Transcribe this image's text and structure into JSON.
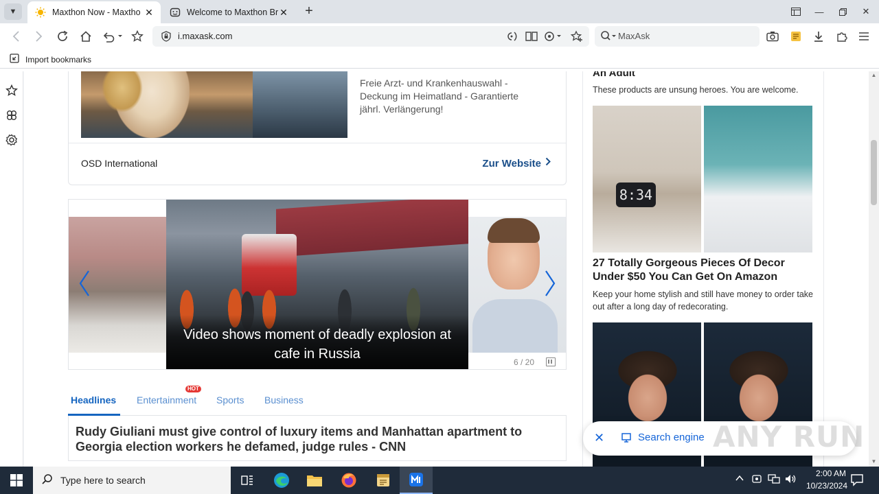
{
  "browser": {
    "tabs": [
      {
        "title": "Maxthon Now - Maxtho",
        "active": true,
        "favicon": "sun-icon"
      },
      {
        "title": "Welcome to Maxthon Br",
        "active": false,
        "favicon": "maxthon-smile-icon"
      }
    ],
    "address_url": "i.maxask.com",
    "search_placeholder": "MaxAsk",
    "bookmark_import_label": "Import bookmarks"
  },
  "ad": {
    "text": "Freie Arzt- und Krankenhauswahl - Deckung im Heimatland - Garantierte jährl. Verlängerung!",
    "source": "OSD International",
    "cta": "Zur Website"
  },
  "carousel": {
    "caption": "Video shows moment of deadly explosion at cafe in Russia",
    "counter": "6 / 20"
  },
  "news": {
    "tabs": [
      "Headlines",
      "Entertainment",
      "Sports",
      "Business"
    ],
    "active_tab": "Headlines",
    "hot_badge": "HOT",
    "headline": "Rudy Giuliani must give control of luxury items and Manhattan apartment to Georgia election workers he defamed, judge rules - CNN"
  },
  "sidebar": {
    "item0_title": "An Adult",
    "item0_desc": "These products are unsung heroes. You are welcome.",
    "item1_clock": "8:34",
    "item1_title": "27 Totally Gorgeous Pieces Of Decor Under $50 You Can Get On Amazon",
    "item1_desc": "Keep your home stylish and still have money to order take out after a long day of redecorating."
  },
  "pill": {
    "search_engine_label": "Search engine"
  },
  "watermark": "ANY RUN",
  "taskbar": {
    "search_placeholder": "Type here to search",
    "time": "2:00 AM",
    "date": "10/23/2024"
  },
  "colors": {
    "accent": "#1565d8",
    "link_dark": "#1b4f8a",
    "hot": "#e53935",
    "taskbar": "#1f2b3a"
  }
}
